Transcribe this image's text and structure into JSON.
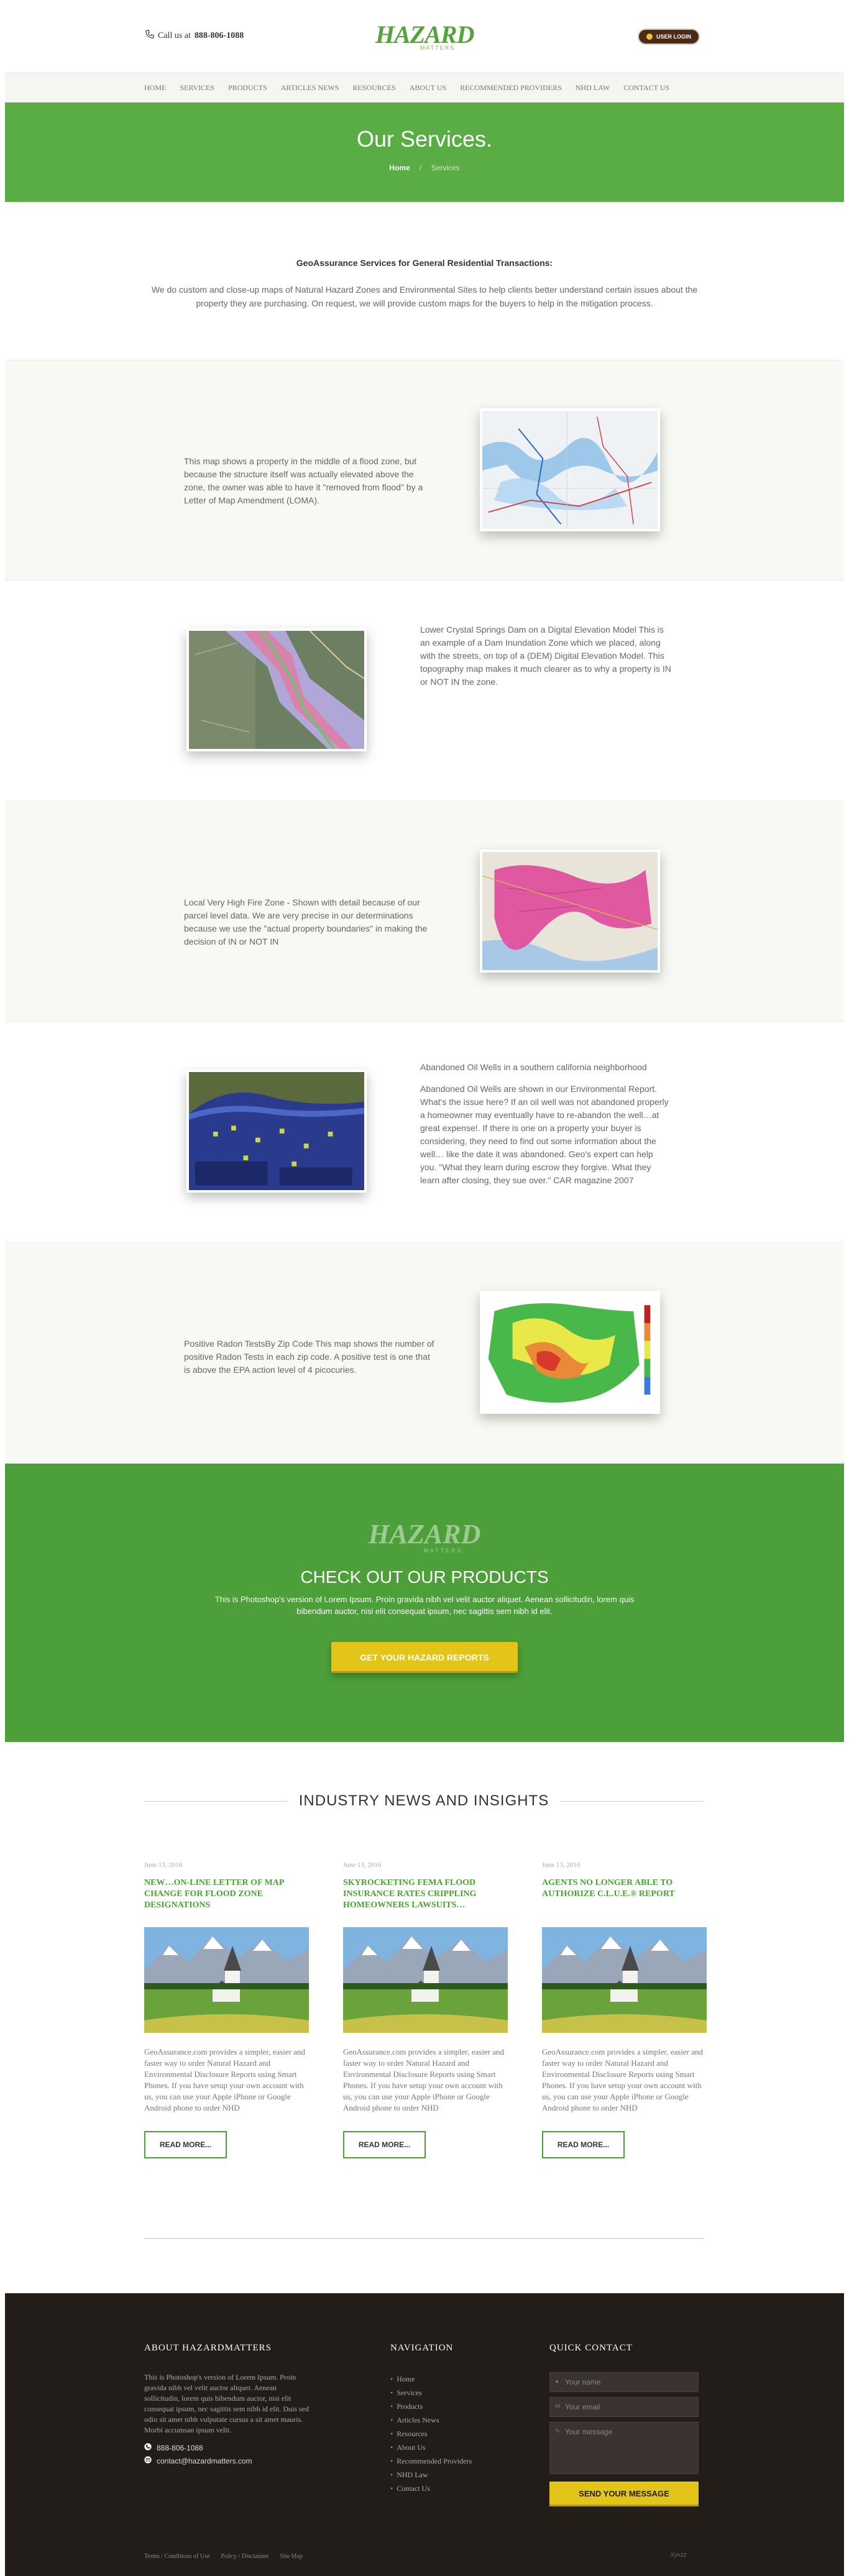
{
  "header": {
    "phone_prefix": "Call us at",
    "phone_number": "888-806-1088",
    "logo_text": "HAZARD",
    "logo_sub": "MATTERS",
    "login_label": "USER LOGIN"
  },
  "nav": {
    "items": [
      "HOME",
      "SERVICES",
      "PRODUCTS",
      "ARTICLES NEWS",
      "RESOURCES",
      "ABOUT US",
      "RECOMMENDED PROVIDERS",
      "NHD LAW",
      "CONTACT US"
    ]
  },
  "hero": {
    "title": "Our Services.",
    "crumb_home": "Home",
    "crumb_sep": "/",
    "crumb_current": "Services"
  },
  "intro": {
    "heading": "GeoAssurance Services for General Residential Transactions:",
    "body": "We do custom and close-up maps of Natural Hazard Zones and Environmental Sites to help clients better understand certain issues about the property they are purchasing. On request, we will provide custom maps for the buyers to help in the mitigation process."
  },
  "services": [
    {
      "text": "This map shows a property in the middle of a flood zone, but because the structure itself was actually elevated above the zone, the owner was able to have it \"removed from flood\" by a Letter of Map Amendment (LOMA)."
    },
    {
      "text": "Lower Crystal Springs Dam on a Digital Elevation Model This is an example of a Dam Inundation Zone which we placed, along with the streets, on top of a (DEM) Digital Elevation Model. This topography map makes it much clearer as to why a property is IN or NOT IN the zone."
    },
    {
      "text": "Local Very High Fire Zone - Shown with detail because of our parcel level data. We are very precise in our determinations because we use the \"actual property boundaries\" in making the decision of IN or NOT IN"
    },
    {
      "title": "Abandoned Oil Wells in a southern california neighborhood",
      "text": "Abandoned Oil Wells are shown in our Environmental Report. What's the issue here? If an oil well was not abandoned properly a homeowner may eventually have to re-abandon the well…at great expense!. If there is one on a property your buyer is considering, they need to find out some information about the well… like the date it was abandoned. Geo's expert can help you. \"What they learn during escrow they forgive. What they learn after closing, they sue over.\" CAR magazine 2007"
    },
    {
      "text": "Positive Radon TestsBy Zip Code This map shows the number of positive Radon Tests in each zip code. A positive test is one that is above the EPA action level of 4 picocuries."
    }
  ],
  "products": {
    "logo_text": "HAZARD",
    "logo_sub": "MATTERS",
    "title": "CHECK OUT OUR PRODUCTS",
    "body": "This is Photoshop's version of Lorem Ipsum. Proin gravida nibh vel velit auctor aliquet. Aenean sollicitudin, lorem quis bibendum auctor, nisi elit consequat ipsum, nec sagittis sem nibh id elit.",
    "cta": "GET YOUR HAZARD REPORTS"
  },
  "news": {
    "heading": "INDUSTRY NEWS AND INSIGHTS",
    "cards": [
      {
        "date": "June 13, 2016",
        "title": "NEW…ON-LINE LETTER OF MAP CHANGE FOR FLOOD ZONE DESIGNATIONS",
        "excerpt": "GeoAssurance.com provides a simpler, easier and faster way to order Natural Hazard and Environmental Disclosure Reports using Smart Phones. If you have setup your own account with us, you can use your Apple iPhone or Google Android phone to order NHD",
        "more": "READ MORE..."
      },
      {
        "date": "June 13, 2016",
        "title": "SKYROCKETING FEMA FLOOD INSURANCE RATES CRIPPLING HOMEOWNERS LAWSUITS…",
        "excerpt": "GeoAssurance.com provides a simpler, easier and faster way to order Natural Hazard and Environmental Disclosure Reports using Smart Phones. If you have setup your own account with us, you can use your Apple iPhone or Google Android phone to order NHD",
        "more": "READ MORE..."
      },
      {
        "date": "June 13, 2016",
        "title": "AGENTS NO LONGER ABLE TO AUTHORIZE C.L.U.E.® REPORT",
        "excerpt": "GeoAssurance.com provides a simpler, easier and faster way to order Natural Hazard and Environmental Disclosure Reports using Smart Phones. If you have setup your own account with us, you can use your Apple iPhone or Google Android phone to order NHD",
        "more": "READ MORE..."
      }
    ]
  },
  "footer": {
    "about_title": "ABOUT HAZARDMATTERS",
    "about_text": "This is Photoshop's version of Lorem Ipsum. Proin gravida nibh vel velit auctor aliquet. Aenean sollicitudin, lorem quis bibendum auctor, nisi elit consequat ipsum, nec sagittis sem nibh id elit. Duis sed odio sit amet nibh vulputate cursus a sit amet mauris. Morbi accumsan ipsum velit.",
    "phone": "888-806-1088",
    "email": "contact@hazardmatters.com",
    "nav_title": "NAVIGATION",
    "nav_items": [
      "Home",
      "Services",
      "Products",
      "Articles News",
      "Resources",
      "About Us",
      "Recommended Providers",
      "NHD Law",
      "Contact Us"
    ],
    "contact_title": "QUICK CONTACT",
    "name_placeholder": "Your name",
    "email_placeholder": "Your email",
    "message_placeholder": "Your message",
    "send_label": "SEND YOUR MESSAGE",
    "bottom_links": [
      "Terms / Conditions of Use",
      "Policy / Disclaimer",
      "Site Map"
    ],
    "credit": "Xyxzz"
  },
  "colors": {
    "brand_green": "#5aac45",
    "dark_green": "#4c9f39",
    "cta_yellow": "#e3c51a",
    "footer_bg": "#231d1a",
    "login_brown": "#4a2a18"
  },
  "icons": {
    "phone": "phone-icon",
    "user": "user-icon",
    "email": "email-icon"
  }
}
